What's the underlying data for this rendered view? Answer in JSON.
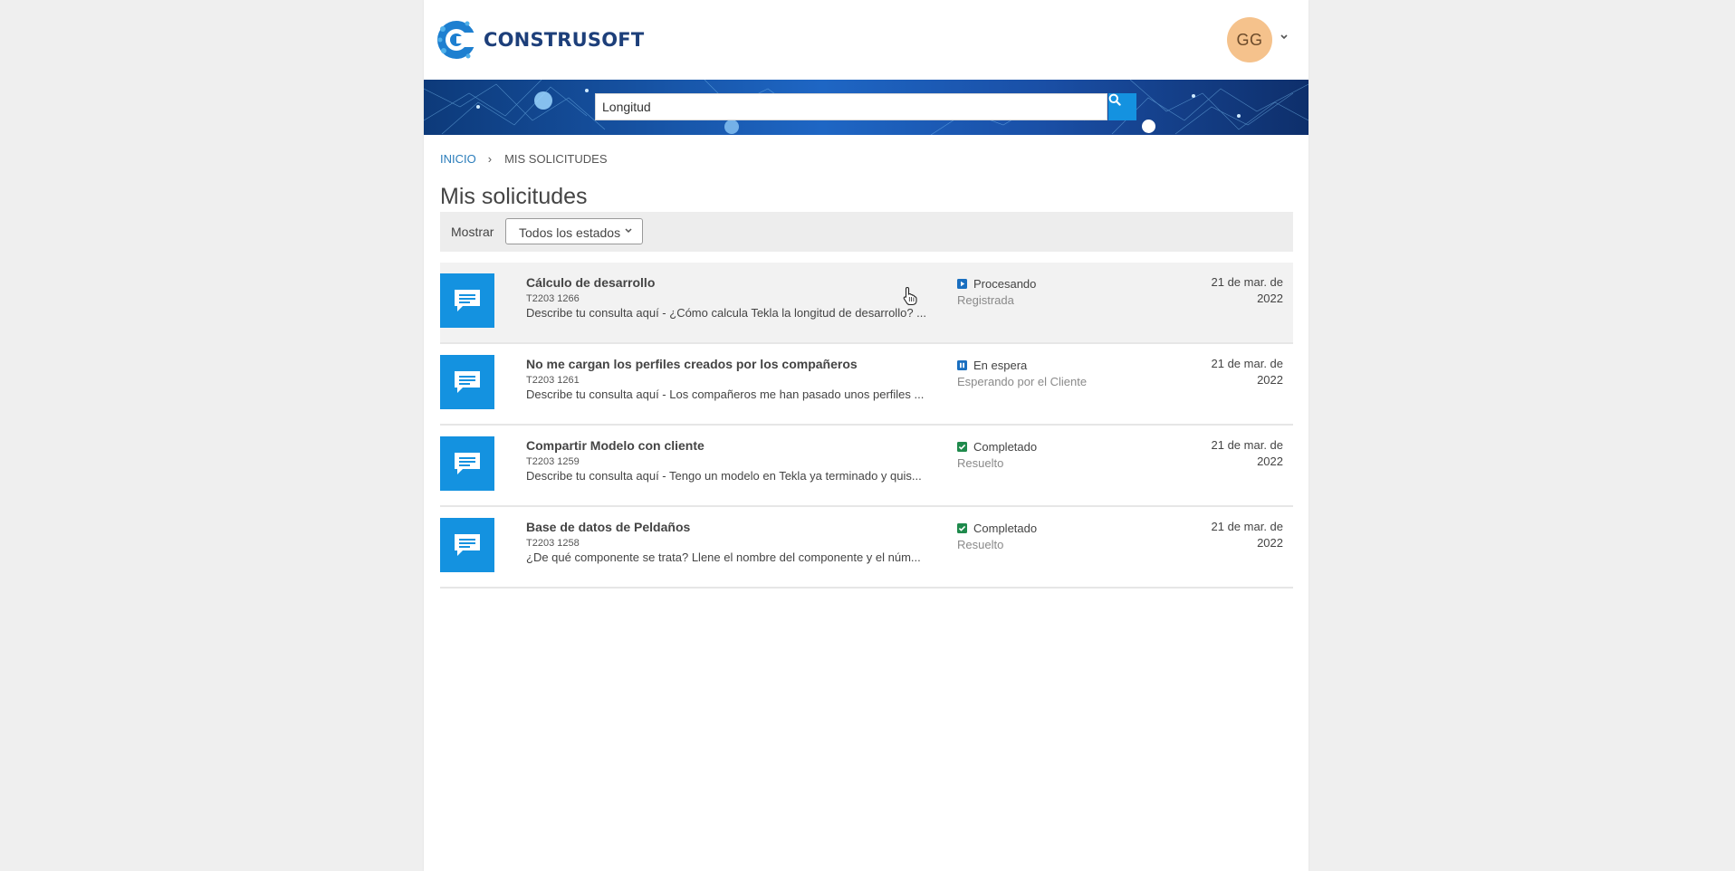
{
  "brand": {
    "name": "CONSTRUSOFT"
  },
  "user": {
    "initials": "GG"
  },
  "search": {
    "value": "Longitud"
  },
  "breadcrumb": {
    "home": "INICIO",
    "separator": "›",
    "current": "MIS SOLICITUDES"
  },
  "page": {
    "title": "Mis solicitudes"
  },
  "filter": {
    "label": "Mostrar",
    "selected": "Todos los estados"
  },
  "requests": [
    {
      "title": "Cálculo de desarrollo",
      "id": "T2203 1266",
      "description": "Describe tu consulta aquí - ¿Cómo calcula Tekla la longitud de desarrollo? ...",
      "status": "Procesando",
      "status_icon": "play-icon",
      "substatus": "Registrada",
      "date_line1": "21 de mar. de",
      "date_line2": "2022"
    },
    {
      "title": "No me cargan los perfiles creados por los compañeros",
      "id": "T2203 1261",
      "description": "Describe tu consulta aquí - Los compañeros me han pasado unos perfiles ...",
      "status": "En espera",
      "status_icon": "pause-icon",
      "substatus": "Esperando por el Cliente",
      "date_line1": "21 de mar. de",
      "date_line2": "2022"
    },
    {
      "title": "Compartir Modelo con cliente",
      "id": "T2203 1259",
      "description": "Describe tu consulta aquí - Tengo un modelo en Tekla ya terminado y quis...",
      "status": "Completado",
      "status_icon": "check-icon",
      "substatus": "Resuelto",
      "date_line1": "21 de mar. de",
      "date_line2": "2022"
    },
    {
      "title": "Base de datos de Peldaños",
      "id": "T2203 1258",
      "description": "¿De qué componente se trata? Llene el nombre del componente y el núm...",
      "status": "Completado",
      "status_icon": "check-icon",
      "substatus": "Resuelto",
      "date_line1": "21 de mar. de",
      "date_line2": "2022"
    }
  ],
  "colors": {
    "accent": "#1492e0",
    "brand_text": "#1d3f7a",
    "status_processing": "#1a6fc0",
    "status_waiting": "#1a6fc0",
    "status_done": "#1f8a4c",
    "avatar_bg": "#f5c28c"
  }
}
